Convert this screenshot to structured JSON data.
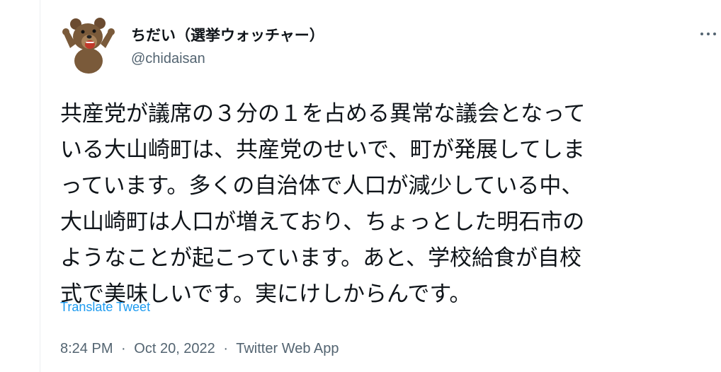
{
  "author": {
    "display_name": "ちだい（選挙ウォッチャー）",
    "handle": "@chidaisan",
    "avatar": "brown-bear-mascot-icon"
  },
  "menu": {
    "icon": "more-options-icon"
  },
  "tweet": {
    "text_lines": [
      "共産党が議席の３分の１を占める異常な議会となって",
      "いる大山崎町は、共産党のせいで、町が発展してしま",
      "っています。多くの自治体で人口が減少している中、",
      "大山崎町は人口が増えており、ちょっとした明石市の",
      "ようなことが起こっています。あと、学校給食が自校",
      "式で美味しいです。実にけしからんです。"
    ],
    "translate_label": "Translate Tweet"
  },
  "metadata": {
    "time": "8:24 PM",
    "separator": "·",
    "date": "Oct 20, 2022",
    "source": "Twitter Web App"
  },
  "colors": {
    "text": "#0f1419",
    "secondary": "#536471",
    "link": "#1d9bf0",
    "bear_fur": "#7a5a3a",
    "bear_mouth": "#c0392b"
  }
}
